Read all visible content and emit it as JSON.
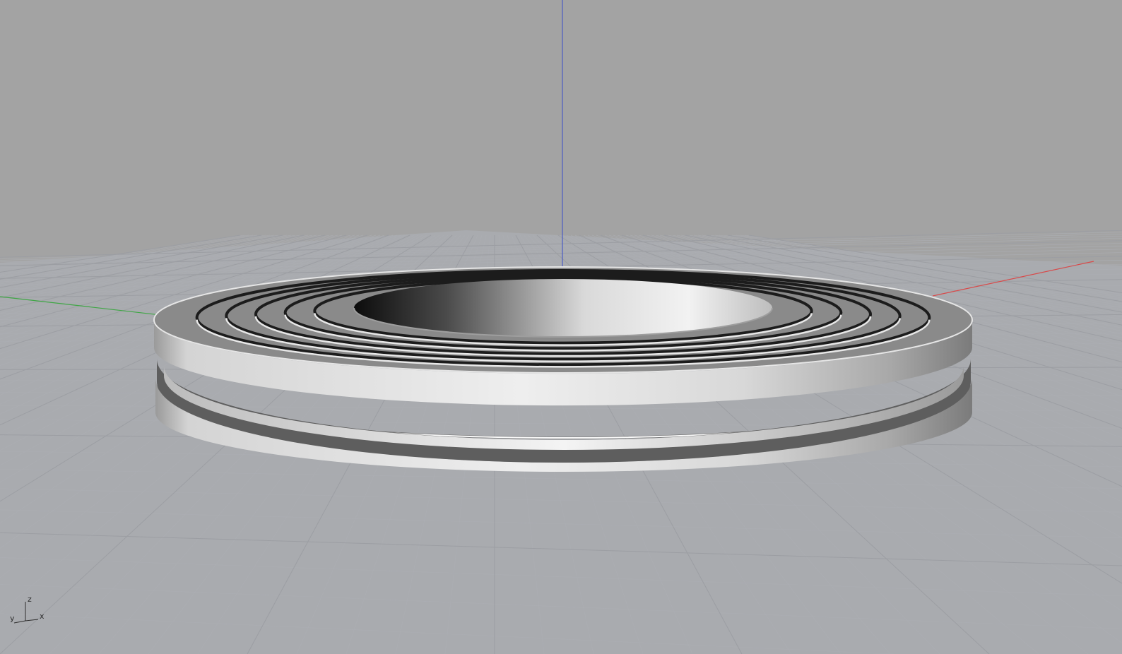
{
  "viewport": {
    "background": "#a3a3a3",
    "projection": "perspective"
  },
  "grid": {
    "color": "#b4b6bc",
    "minor_color": "#acaeb3",
    "major_color": "#9c9ea3"
  },
  "world_axes": {
    "x_color": "#d84a4a",
    "y_color": "#3fa645",
    "z_color": "#4a5cc4"
  },
  "model": {
    "object": "grooved-ring",
    "shading": "shaded",
    "groove_count": 5
  },
  "axis_widget": {
    "x_label": "x",
    "y_label": "y",
    "z_label": "z",
    "icon": "axis-triad-icon"
  }
}
